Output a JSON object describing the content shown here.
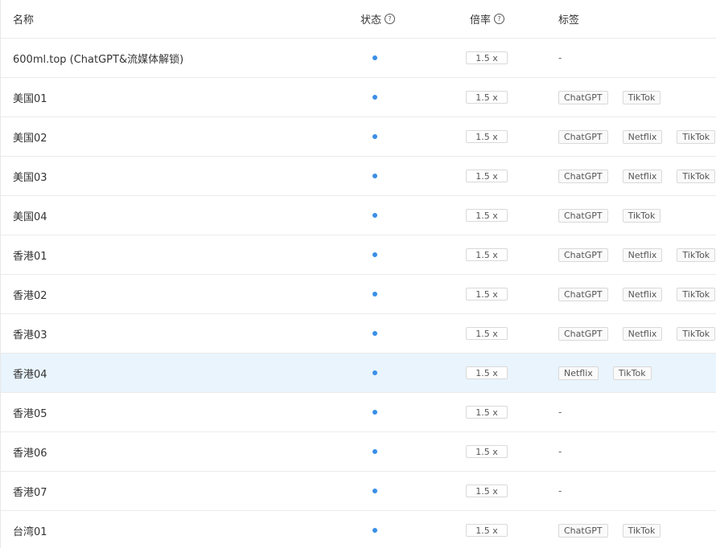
{
  "header": {
    "name": "名称",
    "status": "状态",
    "rate": "倍率",
    "tags": "标签",
    "help_glyph": "?"
  },
  "rows": [
    {
      "name": "600ml.top (ChatGPT&流媒体解锁)",
      "rate": "1.5 x",
      "tags": [],
      "empty": "-"
    },
    {
      "name": "美国01",
      "rate": "1.5 x",
      "tags": [
        "ChatGPT",
        "TikTok"
      ]
    },
    {
      "name": "美国02",
      "rate": "1.5 x",
      "tags": [
        "ChatGPT",
        "Netflix",
        "TikTok"
      ]
    },
    {
      "name": "美国03",
      "rate": "1.5 x",
      "tags": [
        "ChatGPT",
        "Netflix",
        "TikTok"
      ]
    },
    {
      "name": "美国04",
      "rate": "1.5 x",
      "tags": [
        "ChatGPT",
        "TikTok"
      ]
    },
    {
      "name": "香港01",
      "rate": "1.5 x",
      "tags": [
        "ChatGPT",
        "Netflix",
        "TikTok"
      ]
    },
    {
      "name": "香港02",
      "rate": "1.5 x",
      "tags": [
        "ChatGPT",
        "Netflix",
        "TikTok"
      ]
    },
    {
      "name": "香港03",
      "rate": "1.5 x",
      "tags": [
        "ChatGPT",
        "Netflix",
        "TikTok"
      ]
    },
    {
      "name": "香港04",
      "rate": "1.5 x",
      "tags": [
        "Netflix",
        "TikTok"
      ],
      "highlight": true
    },
    {
      "name": "香港05",
      "rate": "1.5 x",
      "tags": [],
      "empty": "-"
    },
    {
      "name": "香港06",
      "rate": "1.5 x",
      "tags": [],
      "empty": "-"
    },
    {
      "name": "香港07",
      "rate": "1.5 x",
      "tags": [],
      "empty": "-"
    },
    {
      "name": "台湾01",
      "rate": "1.5 x",
      "tags": [
        "ChatGPT",
        "TikTok"
      ]
    }
  ],
  "colors": {
    "status_dot": "#3a8ee6",
    "highlight_row": "#e9f4fd"
  },
  "icons": {
    "help": "help-circle-icon",
    "status": "status-dot-icon"
  }
}
